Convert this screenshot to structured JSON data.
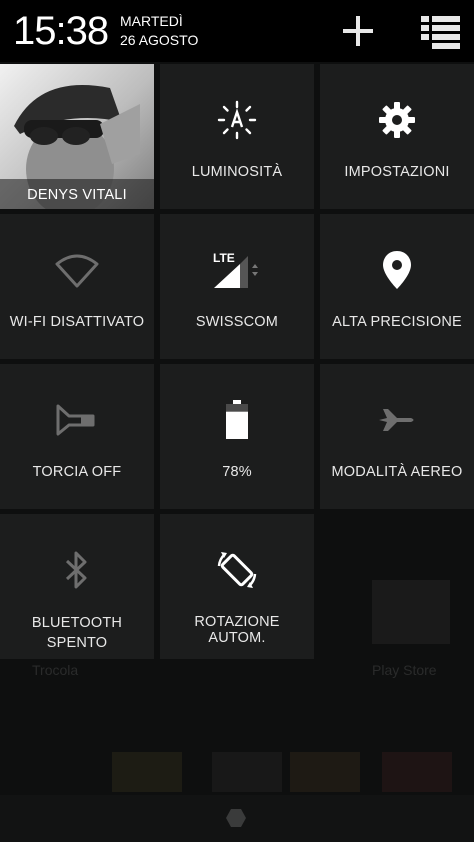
{
  "header": {
    "time": "15:38",
    "day": "MARTEDÌ",
    "date": "26 AGOSTO"
  },
  "tiles": [
    {
      "label": "DENYS VITALI",
      "icon": "avatar"
    },
    {
      "label": "LUMINOSITÀ",
      "icon": "brightness-icon"
    },
    {
      "label": "IMPOSTAZIONI",
      "icon": "gear-icon"
    },
    {
      "label": "WI-FI DISATTIVATO",
      "icon": "wifi-icon"
    },
    {
      "label": "SWISSCOM",
      "icon": "signal-icon",
      "badge": "LTE"
    },
    {
      "label": "ALTA PRECISIONE",
      "icon": "location-icon"
    },
    {
      "label": "TORCIA OFF",
      "icon": "flashlight-icon"
    },
    {
      "label": "78%",
      "icon": "battery-icon",
      "battery_level": 0.78
    },
    {
      "label": "MODALITÀ AEREO",
      "icon": "airplane-icon"
    },
    {
      "label_line1": "BLUETOOTH",
      "label_line2": "SPENTO",
      "icon": "bluetooth-icon"
    },
    {
      "label": "ROTAZIONE AUTOM.",
      "icon": "rotation-icon"
    }
  ],
  "background": {
    "left_label": "Trocola",
    "right_label": "Play Store"
  },
  "colors": {
    "header_bg": "#000000",
    "tile_bg": "#1c1d1d",
    "icon_active": "#ffffff",
    "icon_inactive": "#6e6e6e"
  }
}
